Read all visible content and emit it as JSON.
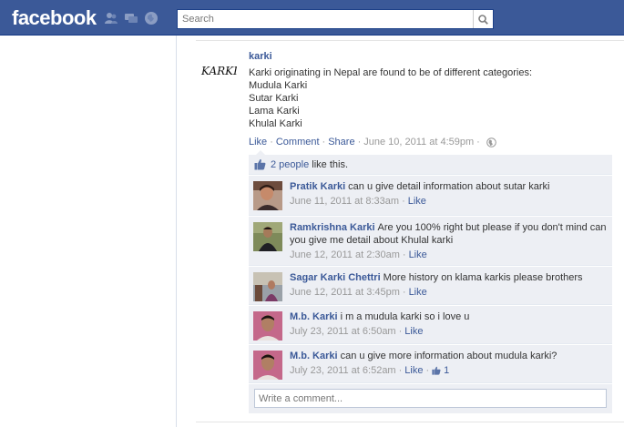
{
  "header": {
    "logo": "facebook",
    "search": {
      "placeholder": "Search",
      "value": ""
    },
    "jewels": [
      "friend-requests-icon",
      "messages-icon",
      "notifications-icon"
    ],
    "colors": {
      "bar": "#3b5998",
      "link": "#3b5998"
    }
  },
  "post": {
    "avatar_text": "KARKI",
    "author": "karki",
    "lines": [
      "Karki originating in Nepal are found to be of different categories:",
      "Mudula Karki",
      "Sutar Karki",
      "Lama Karki",
      "Khulal Karki"
    ],
    "actions": {
      "like": "Like",
      "comment": "Comment",
      "share": "Share"
    },
    "timestamp": "June 10, 2011 at 4:59pm"
  },
  "likes": {
    "count_link": "2 people",
    "suffix": "like this."
  },
  "comments": [
    {
      "author": "Pratik Karki",
      "text": "can u give detail information about sutar karki",
      "time": "June 11, 2011 at 8:33am",
      "like": "Like",
      "likes": ""
    },
    {
      "author": "Ramkrishna Karki",
      "text": "Are you 100% right but please if you don't mind can you give me detail about Khulal karki",
      "time": "June 12, 2011 at 2:30am",
      "like": "Like",
      "likes": ""
    },
    {
      "author": "Sagar Karki Chettri",
      "text": "More history on klama karkis please brothers",
      "time": "June 12, 2011 at 3:45pm",
      "like": "Like",
      "likes": ""
    },
    {
      "author": "M.b. Karki",
      "text": "i m a mudula karki so i love u",
      "time": "July 23, 2011 at 6:50am",
      "like": "Like",
      "likes": ""
    },
    {
      "author": "M.b. Karki",
      "text": "can u give more information about mudula karki?",
      "time": "July 23, 2011 at 6:52am",
      "like": "Like",
      "likes": "1"
    }
  ],
  "write_comment": {
    "placeholder": "Write a comment..."
  }
}
